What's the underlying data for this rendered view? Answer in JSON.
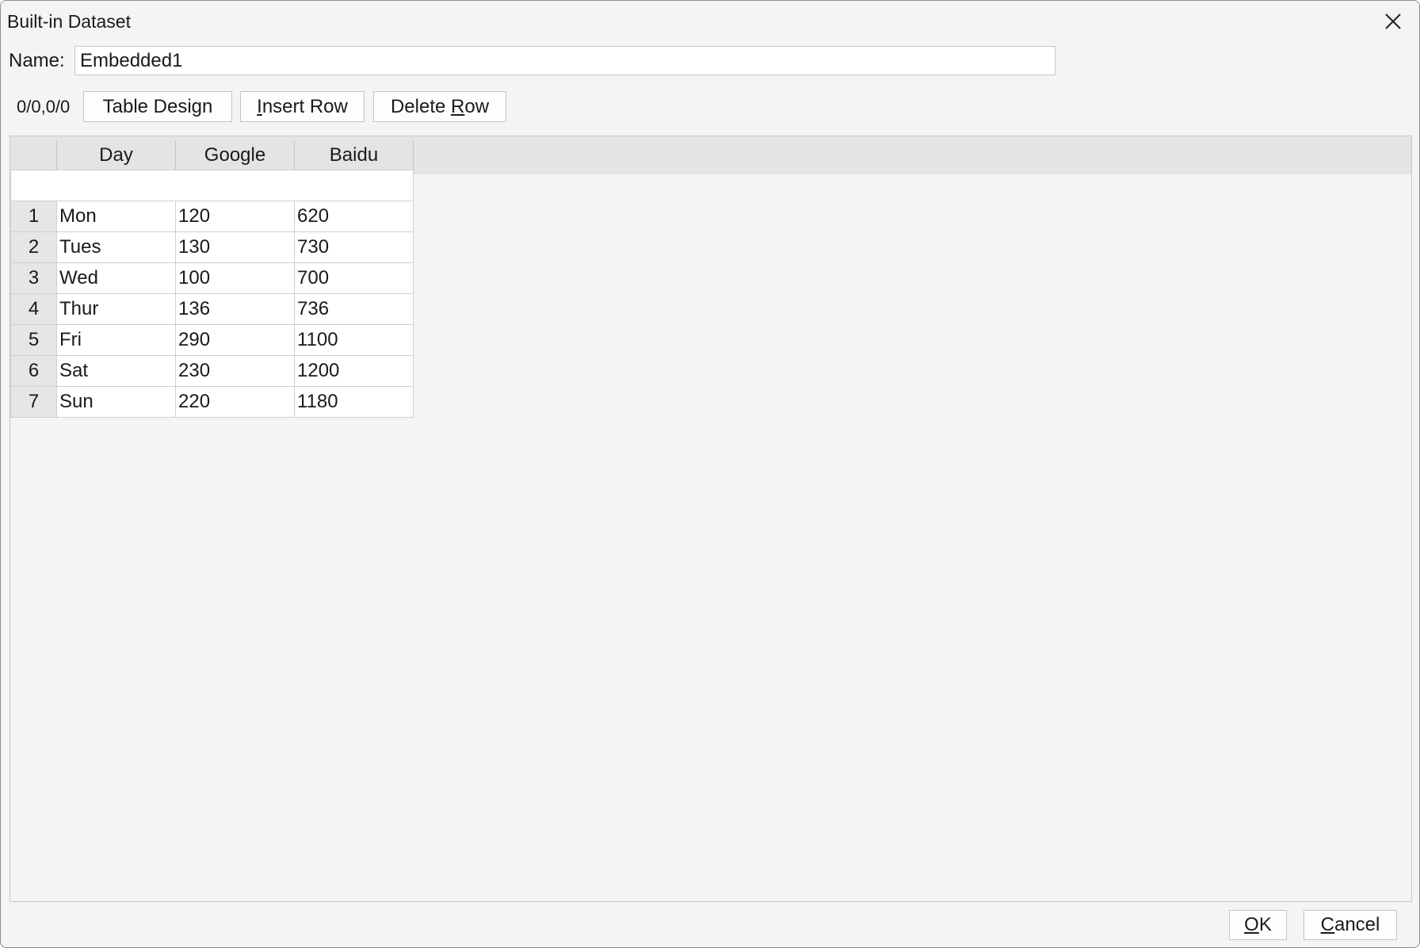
{
  "window": {
    "title": "Built-in Dataset"
  },
  "name_field": {
    "label": "Name:",
    "value": "Embedded1"
  },
  "toolbar": {
    "coord_text": "0/0,0/0",
    "table_design_label": "Table Design",
    "insert_row_prefix": "",
    "insert_row_mnemonic": "I",
    "insert_row_rest": "nsert Row",
    "delete_row_prefix": "Delete ",
    "delete_row_mnemonic": "R",
    "delete_row_rest": "ow"
  },
  "table": {
    "columns": [
      "Day",
      "Google",
      "Baidu"
    ],
    "rows": [
      {
        "num": "1",
        "cells": [
          "Mon",
          "120",
          "620"
        ]
      },
      {
        "num": "2",
        "cells": [
          "Tues",
          "130",
          "730"
        ]
      },
      {
        "num": "3",
        "cells": [
          "Wed",
          "100",
          "700"
        ]
      },
      {
        "num": "4",
        "cells": [
          "Thur",
          "136",
          "736"
        ]
      },
      {
        "num": "5",
        "cells": [
          "Fri",
          "290",
          "1100"
        ]
      },
      {
        "num": "6",
        "cells": [
          "Sat",
          "230",
          "1200"
        ]
      },
      {
        "num": "7",
        "cells": [
          "Sun",
          "220",
          "1180"
        ]
      }
    ]
  },
  "footer": {
    "ok_mnemonic": "O",
    "ok_rest": "K",
    "cancel_mnemonic": "C",
    "cancel_rest": "ancel"
  },
  "icons": {
    "close": "close-icon"
  }
}
